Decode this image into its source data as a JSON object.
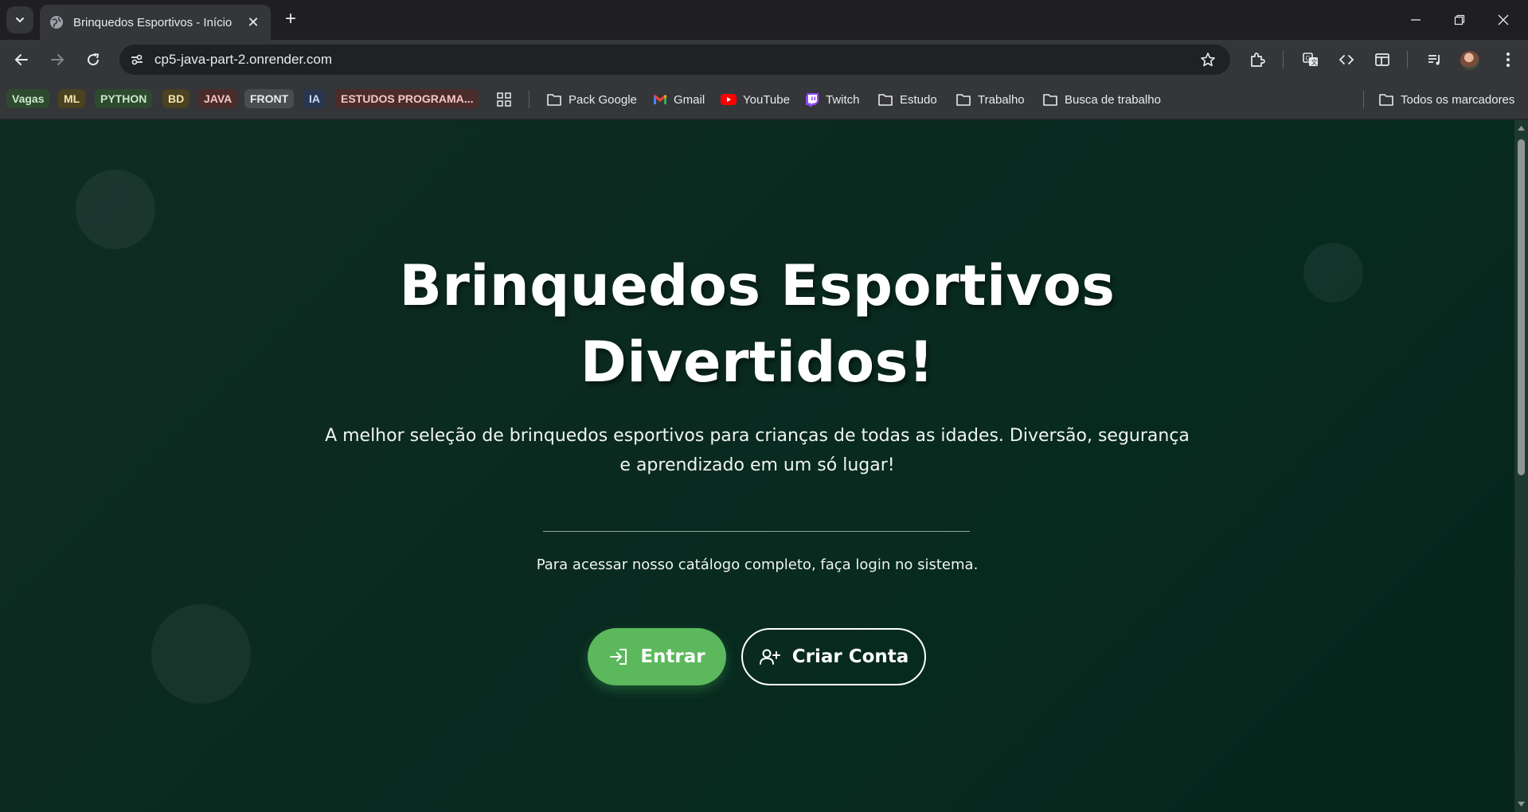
{
  "browser": {
    "tab_title": "Brinquedos Esportivos - Início",
    "url": "cp5-java-part-2.onrender.com",
    "bookmark_chips": [
      {
        "label": "Vagas",
        "bg": "#2d4a2f",
        "fg": "#c8e6c9"
      },
      {
        "label": "ML",
        "bg": "#4a4220",
        "fg": "#f3e5ab"
      },
      {
        "label": "PYTHON",
        "bg": "#2d4a2f",
        "fg": "#c8e6c9"
      },
      {
        "label": "BD",
        "bg": "#4a4220",
        "fg": "#f3e5ab"
      },
      {
        "label": "JAVA",
        "bg": "#4a2c2a",
        "fg": "#f4c7c3"
      },
      {
        "label": "FRONT",
        "bg": "#4a4c50",
        "fg": "#e8eaed"
      },
      {
        "label": "IA",
        "bg": "#2a3550",
        "fg": "#c6dafc"
      },
      {
        "label": "ESTUDOS PROGRAMA...",
        "bg": "#4a2c2a",
        "fg": "#f4c7c3"
      }
    ],
    "bookmarks": [
      {
        "label": "Pack Google",
        "icon": "folder-icon"
      },
      {
        "label": "Gmail",
        "icon": "gmail-icon"
      },
      {
        "label": "YouTube",
        "icon": "youtube-icon"
      },
      {
        "label": "Twitch",
        "icon": "twitch-icon"
      },
      {
        "label": "Estudo",
        "icon": "folder-icon"
      },
      {
        "label": "Trabalho",
        "icon": "folder-icon"
      },
      {
        "label": "Busca de trabalho",
        "icon": "folder-icon"
      }
    ],
    "all_bookmarks_label": "Todos os marcadores"
  },
  "hero": {
    "title_line1": "Brinquedos Esportivos",
    "title_line2": "Divertidos!",
    "subtitle": "A melhor seleção de brinquedos esportivos para crianças de todas as idades. Diversão, segurança e aprendizado em um só lugar!",
    "login_message": "Para acessar nosso catálogo completo, faça login no sistema.",
    "enter_label": "Entrar",
    "create_account_label": "Criar Conta"
  },
  "colors": {
    "background": "#0b2a20",
    "accent_green": "#5cb85c"
  }
}
